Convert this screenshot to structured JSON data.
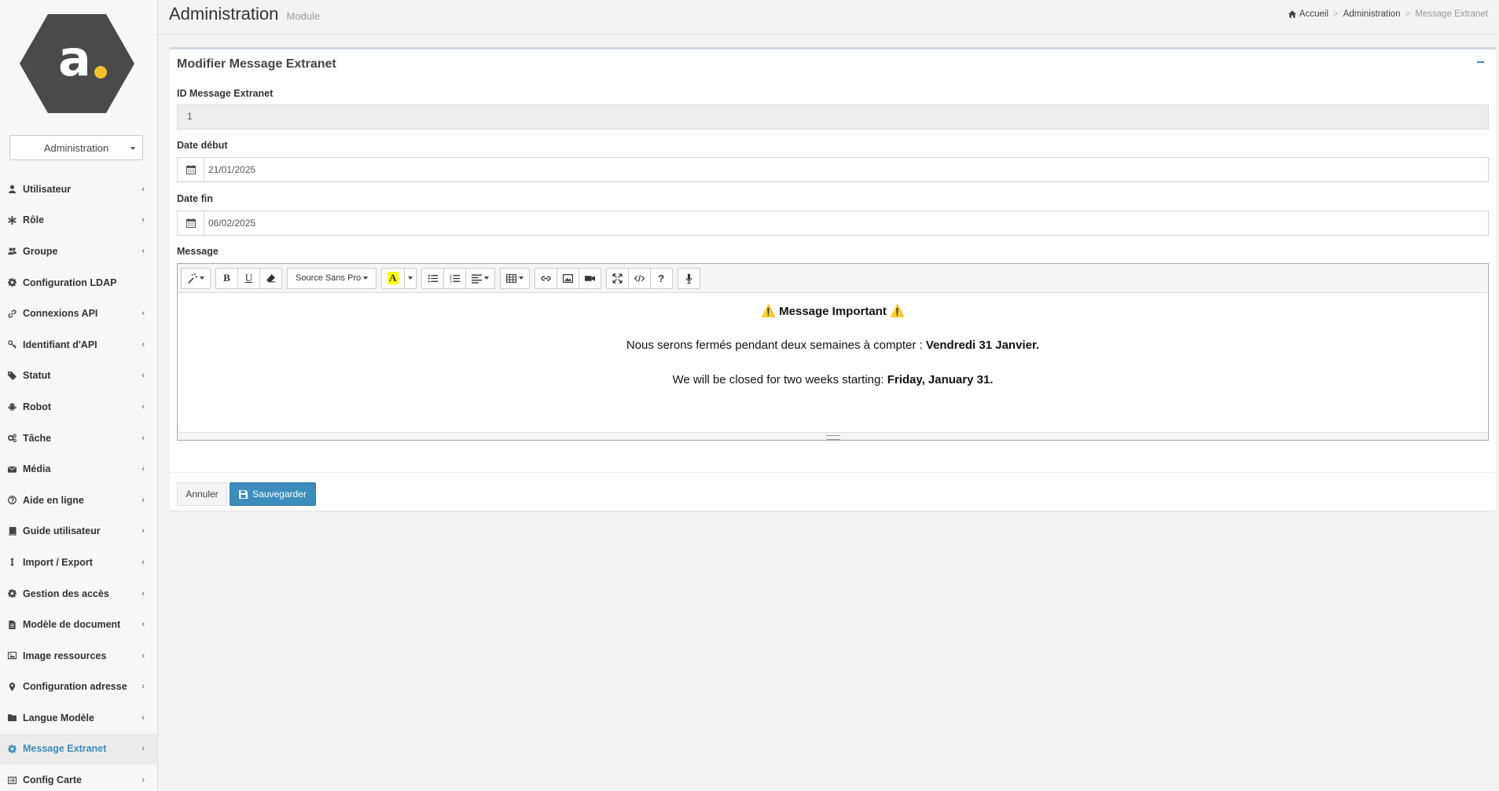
{
  "app": {
    "logo_letter": "a",
    "accent_color": "#3c8dbc",
    "logo_dot_color": "#f2c12e",
    "logo_hex_color": "#4a4a4a"
  },
  "sidebar": {
    "module_select": "Administration",
    "items": [
      {
        "label": "Utilisateur",
        "icon": "user-icon",
        "chevron": "‹"
      },
      {
        "label": "Rôle",
        "icon": "asterisk-icon",
        "chevron": "‹"
      },
      {
        "label": "Groupe",
        "icon": "users-icon",
        "chevron": "‹"
      },
      {
        "label": "Configuration LDAP",
        "icon": "gear-icon",
        "chevron": ""
      },
      {
        "label": "Connexions API",
        "icon": "link-icon",
        "chevron": "‹"
      },
      {
        "label": "Identifiant d'API",
        "icon": "key-icon",
        "chevron": "‹"
      },
      {
        "label": "Statut",
        "icon": "tags-icon",
        "chevron": "‹"
      },
      {
        "label": "Robot",
        "icon": "android-icon",
        "chevron": "‹"
      },
      {
        "label": "Tâche",
        "icon": "gears-icon",
        "chevron": "‹"
      },
      {
        "label": "Média",
        "icon": "envelope-icon",
        "chevron": "‹"
      },
      {
        "label": "Aide en ligne",
        "icon": "question-circle-icon",
        "chevron": "‹"
      },
      {
        "label": "Guide utilisateur",
        "icon": "book-icon",
        "chevron": "›"
      },
      {
        "label": "Import / Export",
        "icon": "arrows-v-icon",
        "chevron": "‹"
      },
      {
        "label": "Gestion des accès",
        "icon": "gear-icon",
        "chevron": "‹"
      },
      {
        "label": "Modèle de document",
        "icon": "file-icon",
        "chevron": "‹"
      },
      {
        "label": "Image ressources",
        "icon": "image-icon",
        "chevron": "‹"
      },
      {
        "label": "Configuration adresse",
        "icon": "map-marker-icon",
        "chevron": "›"
      },
      {
        "label": "Langue Modèle",
        "icon": "folder-icon",
        "chevron": "‹"
      },
      {
        "label": "Message Extranet",
        "icon": "gear-icon",
        "chevron": "›",
        "active": true
      },
      {
        "label": "Config Carte",
        "icon": "list-alt-icon",
        "chevron": "›"
      }
    ]
  },
  "header": {
    "title": "Administration",
    "subtitle": "Module",
    "breadcrumb": {
      "home": "Accueil",
      "parent": "Administration",
      "current": "Message Extranet",
      "separator": ">"
    }
  },
  "form": {
    "box_title": "Modifier Message Extranet",
    "id_label": "ID Message Extranet",
    "id_value": "1",
    "start_label": "Date début",
    "start_value": "21/01/2025",
    "end_label": "Date fin",
    "end_value": "06/02/2025",
    "message_label": "Message",
    "toolbar": {
      "font_name": "Source Sans Pro",
      "bold": "B",
      "underline": "U",
      "color": "A",
      "help": "?"
    },
    "message": {
      "line1_prefix": "⚠️ ",
      "line1_bold": "Message Important",
      "line1_suffix": " ⚠️",
      "line2_text": "Nous serons fermés pendant deux semaines à compter : ",
      "line2_bold": "Vendredi 31 Janvier.",
      "line3_text": "We will be closed for two weeks starting: ",
      "line3_bold": "Friday, January 31."
    },
    "cancel_label": "Annuler",
    "save_label": "Sauvegarder"
  }
}
